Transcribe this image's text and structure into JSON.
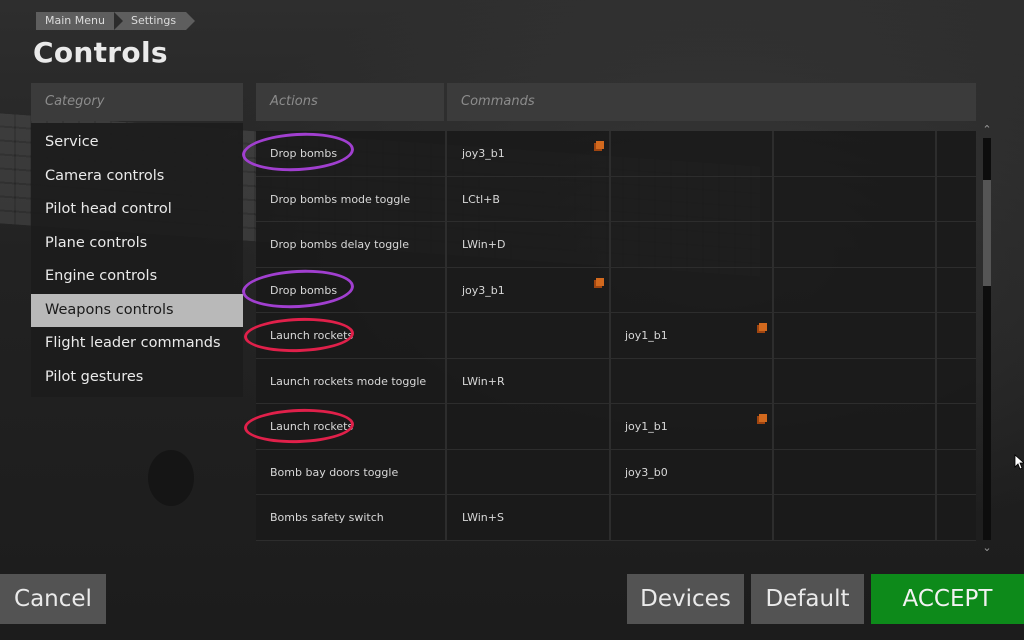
{
  "breadcrumb": [
    "Main Menu",
    "Settings"
  ],
  "page": {
    "title": "Controls"
  },
  "category": {
    "header": "Category",
    "items": [
      {
        "label": "Service"
      },
      {
        "label": "Camera controls"
      },
      {
        "label": "Pilot head control"
      },
      {
        "label": "Plane controls"
      },
      {
        "label": "Engine controls"
      },
      {
        "label": "Weapons controls",
        "active": true
      },
      {
        "label": "Flight leader commands"
      },
      {
        "label": "Pilot gestures"
      }
    ]
  },
  "table": {
    "headers": {
      "actions": "Actions",
      "commands": "Commands"
    },
    "rows": [
      {
        "action": "Drop bombs",
        "cmd1": "joy3_b1",
        "cmd2": "",
        "cmd3": "",
        "duplicate_in": 1,
        "annotation": "purple"
      },
      {
        "action": "Drop bombs mode toggle",
        "cmd1": "LCtl+B",
        "cmd2": "",
        "cmd3": ""
      },
      {
        "action": "Drop bombs delay toggle",
        "cmd1": "LWin+D",
        "cmd2": "",
        "cmd3": ""
      },
      {
        "action": "Drop bombs",
        "cmd1": "joy3_b1",
        "cmd2": "",
        "cmd3": "",
        "duplicate_in": 1,
        "annotation": "purple"
      },
      {
        "action": "Launch rockets",
        "cmd1": "",
        "cmd2": "joy1_b1",
        "cmd3": "",
        "duplicate_in": 2,
        "annotation": "red"
      },
      {
        "action": "Launch rockets mode toggle",
        "cmd1": "LWin+R",
        "cmd2": "",
        "cmd3": ""
      },
      {
        "action": "Launch rockets",
        "cmd1": "",
        "cmd2": "joy1_b1",
        "cmd3": "",
        "duplicate_in": 2,
        "annotation": "red"
      },
      {
        "action": "Bomb bay doors toggle",
        "cmd1": "",
        "cmd2": "joy3_b0",
        "cmd3": ""
      },
      {
        "action": "Bombs safety switch",
        "cmd1": "LWin+S",
        "cmd2": "",
        "cmd3": ""
      }
    ]
  },
  "buttons": {
    "cancel": "Cancel",
    "devices": "Devices",
    "default": "Default",
    "accept": "ACCEPT"
  },
  "colors": {
    "accept": "#0d8a1a",
    "duplicate_marker": "#d2691e",
    "annotation_purple": "#a13fd0",
    "annotation_red": "#e0204a"
  },
  "icons": {
    "scroll_up": "chevron-up-icon",
    "scroll_down": "chevron-down-icon",
    "cursor": "mouse-cursor-icon"
  }
}
